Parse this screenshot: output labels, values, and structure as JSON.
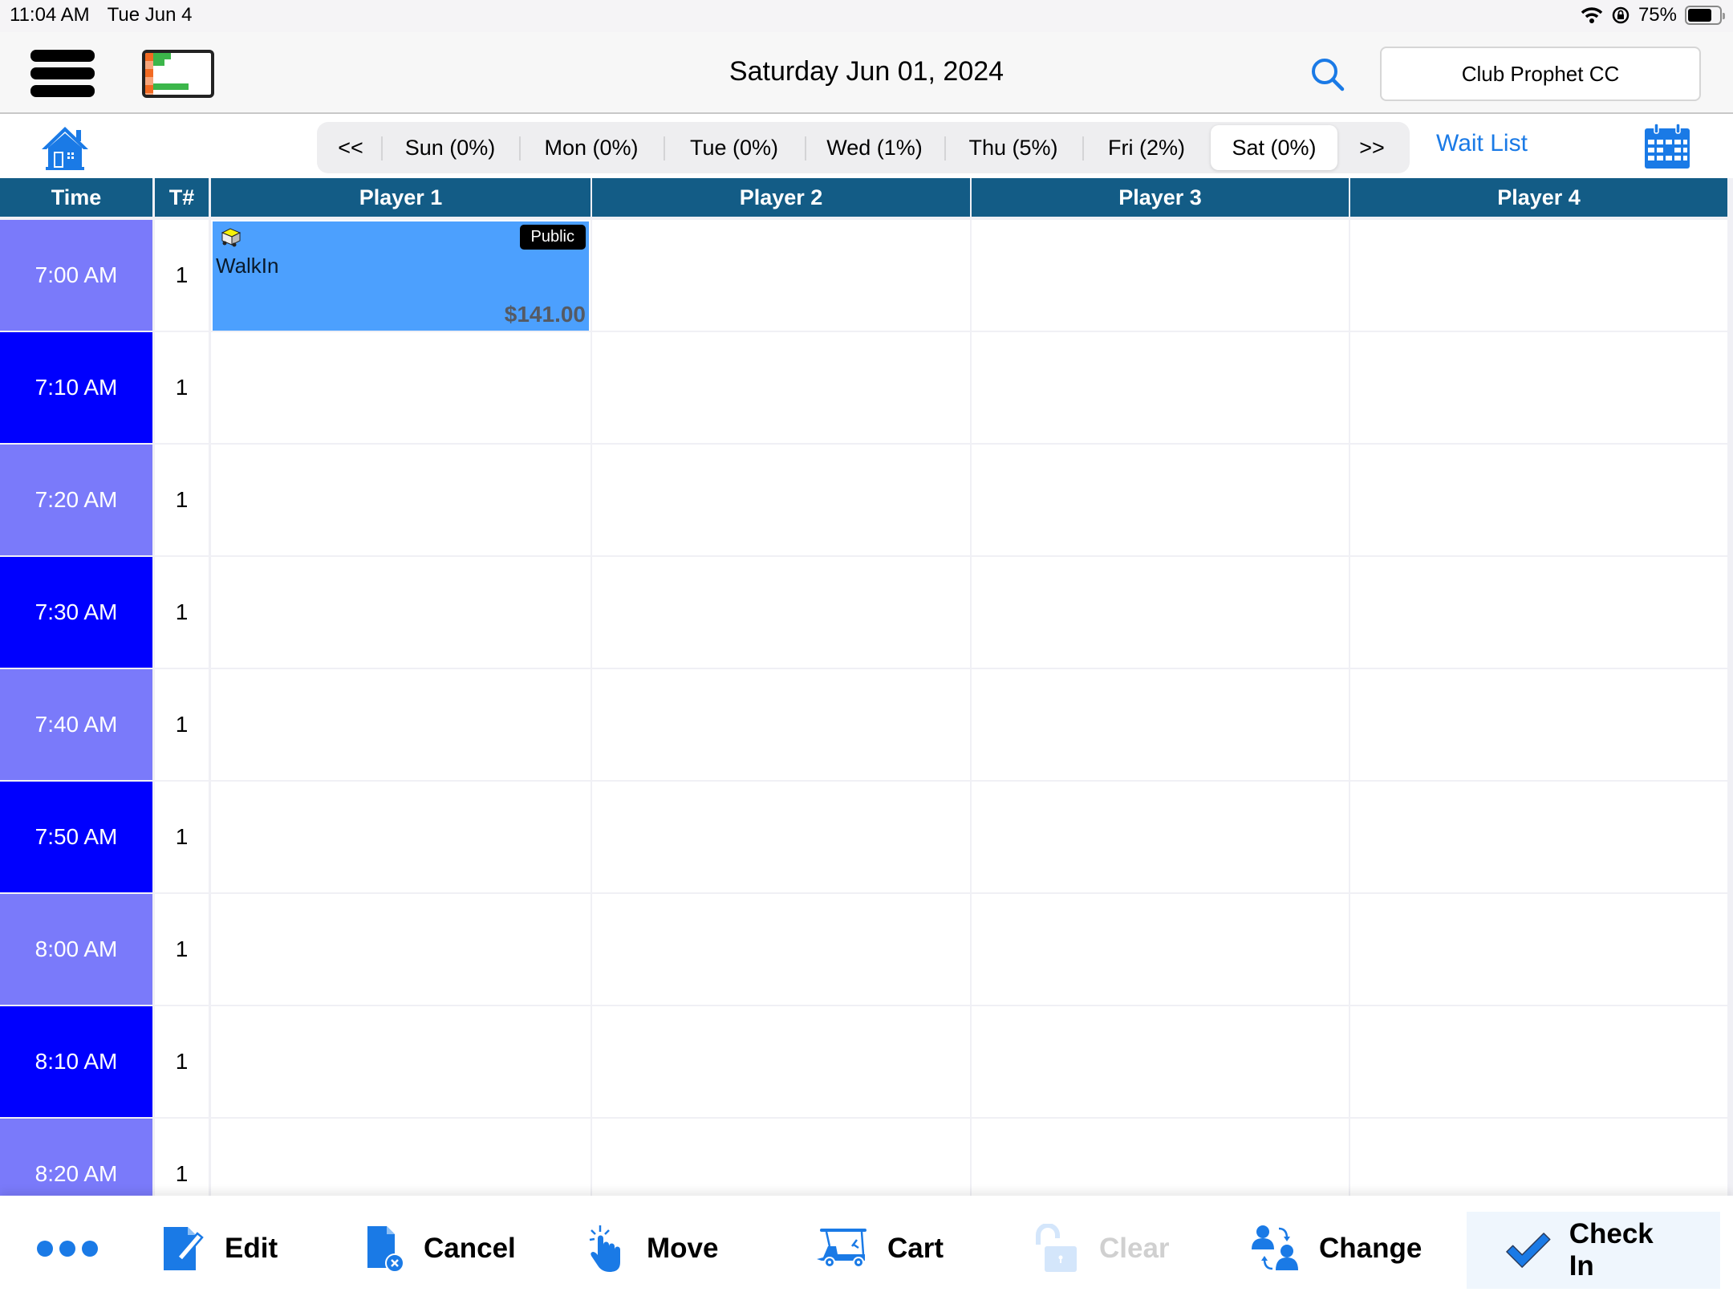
{
  "status_bar": {
    "time": "11:04 AM",
    "date": "Tue Jun 4",
    "battery_percent": "75%",
    "battery_level": 0.75
  },
  "header": {
    "title": "Saturday Jun 01, 2024",
    "club_name": "Club Prophet CC",
    "menu_icon": "hamburger-icon",
    "logo_icon": "tee-sheet-logo-icon",
    "search_icon": "search-icon"
  },
  "day_nav": {
    "prev_label": "<<",
    "next_label": ">>",
    "days": [
      {
        "label": "Sun (0%)",
        "active": false
      },
      {
        "label": "Mon (0%)",
        "active": false
      },
      {
        "label": "Tue (0%)",
        "active": false
      },
      {
        "label": "Wed (1%)",
        "active": false
      },
      {
        "label": "Thu (5%)",
        "active": false
      },
      {
        "label": "Fri (2%)",
        "active": false
      },
      {
        "label": "Sat (0%)",
        "active": true
      }
    ],
    "wait_list_label": "Wait List",
    "home_icon": "home-icon",
    "calendar_icon": "calendar-icon"
  },
  "grid": {
    "headers": [
      "Time",
      "T#",
      "Player 1",
      "Player 2",
      "Player 3",
      "Player 4"
    ],
    "colors": {
      "header_bg": "#135c86",
      "time_light": "#7a7afa",
      "time_dark": "#0000fe",
      "booked_bg": "#4ca0fe"
    },
    "rows": [
      {
        "time": "7:00 AM",
        "tee": "1",
        "shade": "light"
      },
      {
        "time": "7:10 AM",
        "tee": "1",
        "shade": "dark"
      },
      {
        "time": "7:20 AM",
        "tee": "1",
        "shade": "light"
      },
      {
        "time": "7:30 AM",
        "tee": "1",
        "shade": "dark"
      },
      {
        "time": "7:40 AM",
        "tee": "1",
        "shade": "light"
      },
      {
        "time": "7:50 AM",
        "tee": "1",
        "shade": "dark"
      },
      {
        "time": "8:00 AM",
        "tee": "1",
        "shade": "light"
      },
      {
        "time": "8:10 AM",
        "tee": "1",
        "shade": "dark"
      },
      {
        "time": "8:20 AM",
        "tee": "1",
        "shade": "light"
      }
    ],
    "booking": {
      "row": 0,
      "player_slot": 1,
      "name": "WalkIn",
      "badge": "Public",
      "price": "$141.00",
      "icon": "golf-cart-icon"
    }
  },
  "toolbar": {
    "more_icon": "more-dots-icon",
    "buttons": [
      {
        "label": "Edit",
        "icon": "edit-document-icon",
        "enabled": true
      },
      {
        "label": "Cancel",
        "icon": "cancel-document-icon",
        "enabled": true
      },
      {
        "label": "Move",
        "icon": "tap-hand-icon",
        "enabled": true
      },
      {
        "label": "Cart",
        "icon": "golf-cart-icon",
        "enabled": true
      },
      {
        "label": "Clear",
        "icon": "unlock-icon",
        "enabled": false
      },
      {
        "label": "Change",
        "icon": "swap-users-icon",
        "enabled": true
      },
      {
        "label": "Check In",
        "icon": "checkmark-icon",
        "enabled": true
      }
    ]
  }
}
